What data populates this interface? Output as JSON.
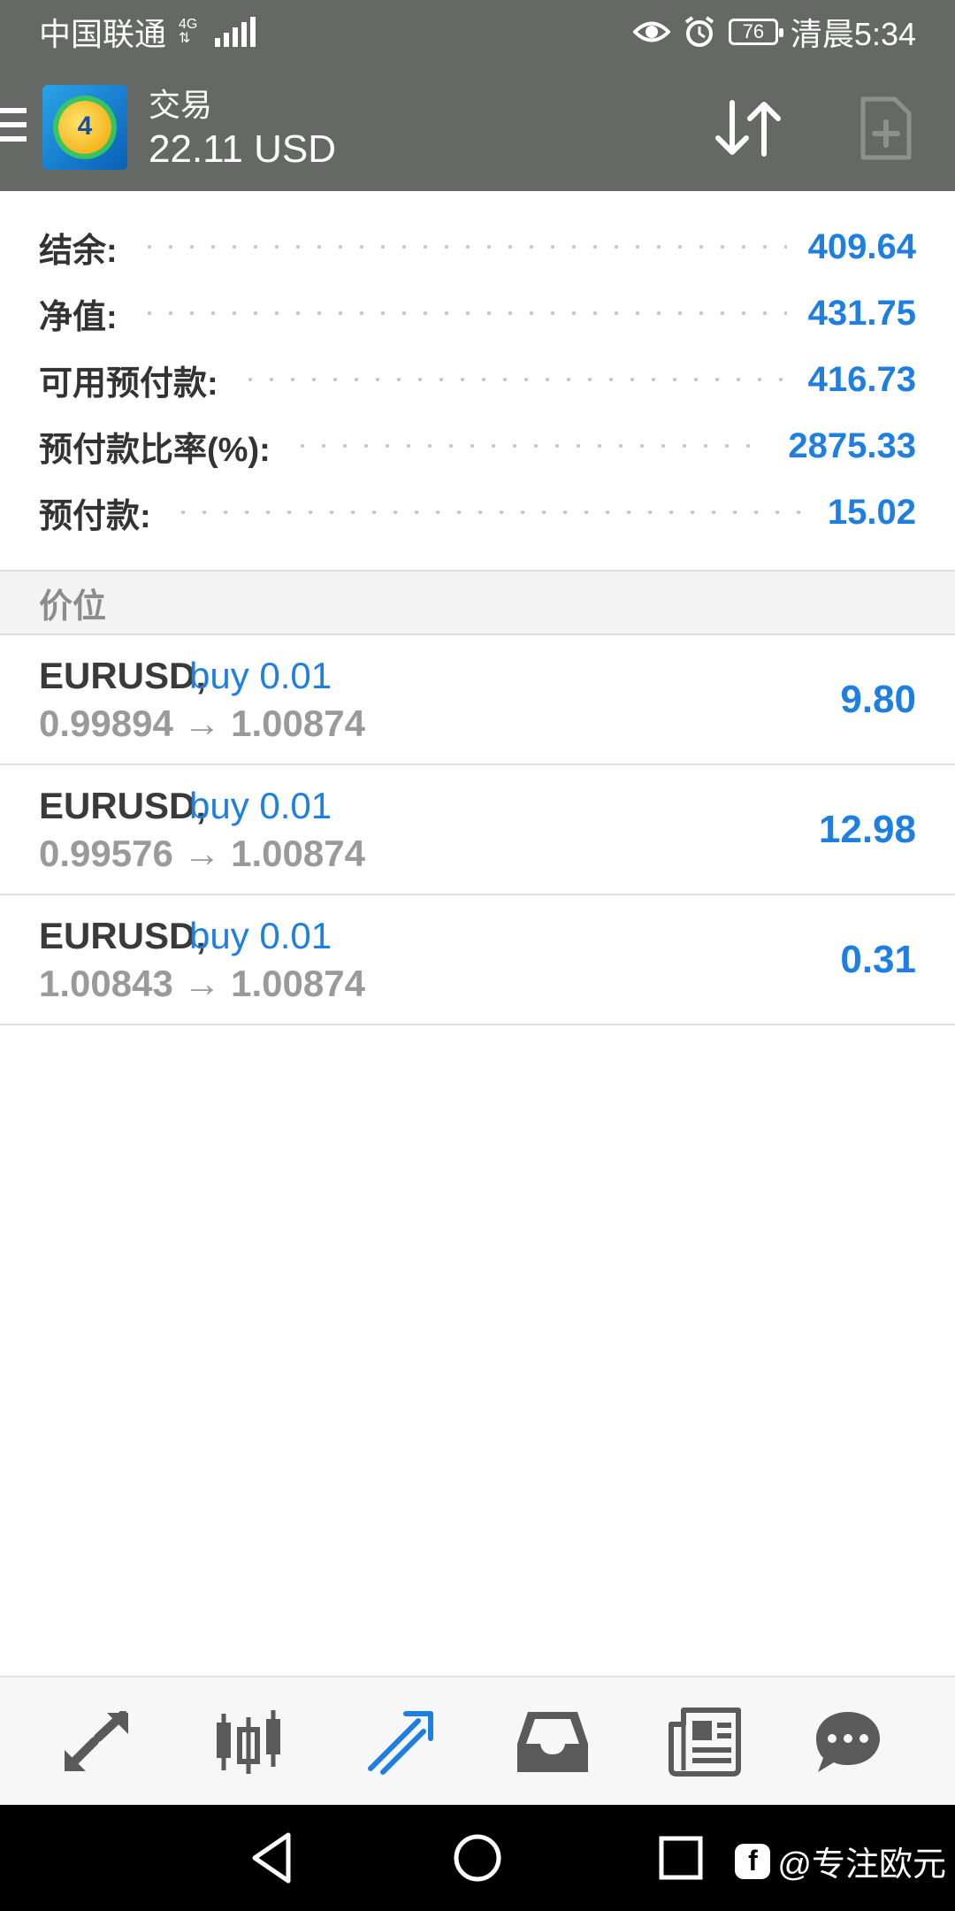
{
  "status_bar": {
    "carrier": "中国联通",
    "network": "4G",
    "battery": "76",
    "time": "清晨5:34"
  },
  "app_bar": {
    "title": "交易",
    "balance": "22.11 USD"
  },
  "account": {
    "rows": [
      {
        "label": "结余:",
        "value": "409.64"
      },
      {
        "label": "净值:",
        "value": "431.75"
      },
      {
        "label": "可用预付款:",
        "value": "416.73"
      },
      {
        "label": "预付款比率(%):",
        "value": "2875.33"
      },
      {
        "label": "预付款:",
        "value": "15.02"
      }
    ]
  },
  "section": {
    "title": "价位"
  },
  "positions": [
    {
      "symbol": "EURUSD,",
      "side": "buy 0.01",
      "prices": "0.99894 → 1.00874",
      "profit": "9.80"
    },
    {
      "symbol": "EURUSD,",
      "side": "buy 0.01",
      "prices": "0.99576 → 1.00874",
      "profit": "12.98"
    },
    {
      "symbol": "EURUSD,",
      "side": "buy 0.01",
      "prices": "1.00843 → 1.00874",
      "profit": "0.31"
    }
  ],
  "bottom_nav": {
    "items": [
      "quotes-icon",
      "chart-icon",
      "trade-icon",
      "history-icon",
      "news-icon",
      "chat-icon"
    ],
    "active": "trade-icon"
  },
  "watermark": {
    "text": "@专注欧元"
  },
  "colors": {
    "appbar_bg": "#666866",
    "accent_blue": "#1f7fe0",
    "label_gray": "#333333",
    "muted_gray": "#9a9a9a"
  }
}
